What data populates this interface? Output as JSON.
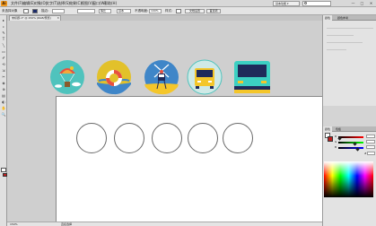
{
  "menubar": {
    "logo": "Ai",
    "items": [
      "文件(F)",
      "编辑(E)",
      "对象(O)",
      "文字(T)",
      "选择(S)",
      "效果(C)",
      "视图(V)",
      "窗口(W)",
      "帮助(H)"
    ],
    "mode": "基本功能 ▾",
    "window_controls": [
      "—",
      "□",
      "✕"
    ]
  },
  "controlbar": {
    "label_selection": "未选择对象",
    "stroke_label": "描边:",
    "stroke_value": "",
    "uniform": "等比",
    "brush": "基本",
    "opacity_label": "不透明度:",
    "opacity_value": "100%",
    "style_label": "样式:",
    "doc_setup": "文档设置",
    "prefs": "首选项"
  },
  "document": {
    "tab_title": "未标题-1* @ 150% (RGB/预览)",
    "close": "✕",
    "status_zoom": "150%",
    "status_tool": "直接选择"
  },
  "panels": {
    "top_tabs": [
      "颜色",
      "颜色参考"
    ],
    "mid_tabs": [
      "颜色",
      "色板"
    ],
    "rgb": {
      "labels": [
        "R",
        "G",
        "B"
      ],
      "values": [],
      "r_level": 0.05,
      "g_level": 0.65,
      "b_level": 0.75
    },
    "hex_label": "#"
  },
  "colors": {
    "teal_bg": "#4fc3bd",
    "yellow_bg": "#e2c12a",
    "blue_bg": "#3f86c8",
    "bus_yellow": "#f4c62a",
    "bus_teal": "#3ccfc2",
    "navy": "#1f2a5a"
  },
  "tools": [
    "▸",
    "▹",
    "✎",
    "T",
    "╲",
    "▭",
    "✐",
    "⟲",
    "⇲",
    "✂",
    "◈",
    "⊕",
    "▤",
    "◐",
    "✋",
    "🔍"
  ]
}
